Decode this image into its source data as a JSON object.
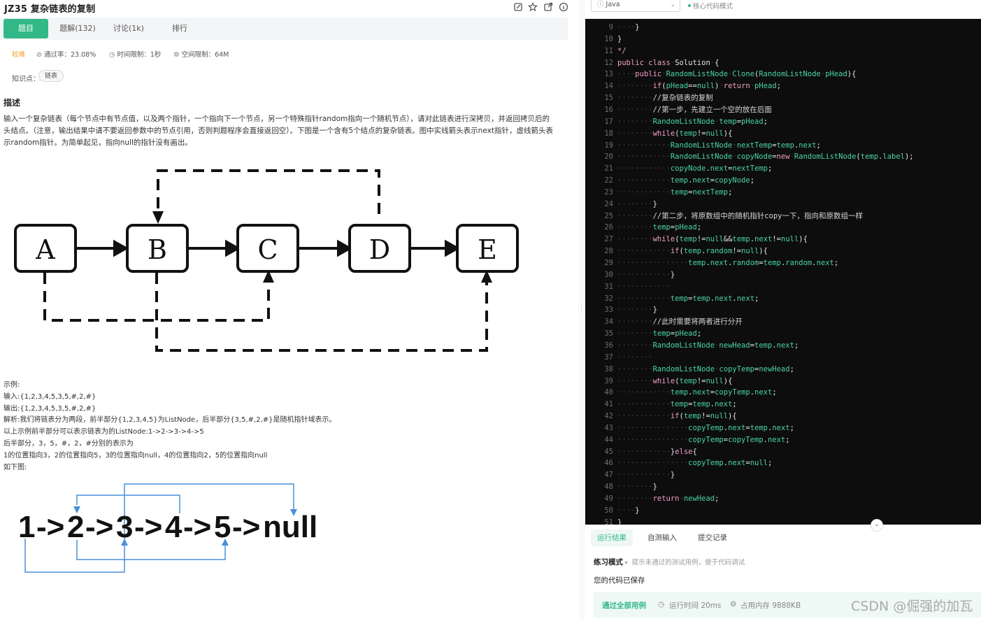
{
  "header": {
    "title": "JZ35  复杂链表的复制"
  },
  "tabs": [
    {
      "label": "题目"
    },
    {
      "label": "题解(132)"
    },
    {
      "label": "讨论(1k)"
    },
    {
      "label": "排行"
    }
  ],
  "meta": {
    "difficulty": "较难",
    "pass_rate": "通过率：23.08%",
    "time_limit": "时间限制：1秒",
    "space_limit": "空间限制：64M"
  },
  "knowledge": {
    "label": "知识点：",
    "tag": "链表"
  },
  "description": {
    "heading": "描述",
    "text": "输入一个复杂链表（每个节点中有节点值，以及两个指针，一个指向下一个节点，另一个特殊指针random指向一个随机节点），请对此链表进行深拷贝，并返回拷贝后的头结点。（注意，输出结果中请不要返回参数中的节点引用，否则判题程序会直接返回空）。下图是一个含有5个结点的复杂链表。图中实线箭头表示next指针，虚线箭头表示random指针。为简单起见，指向null的指针没有画出。"
  },
  "diagram1": {
    "nodes": [
      "A",
      "B",
      "C",
      "D",
      "E"
    ]
  },
  "example": {
    "lines": [
      "示例:",
      "输入:{1,2,3,4,5,3,5,#,2,#}",
      "输出:{1,2,3,4,5,3,5,#,2,#}",
      "解析:我们将链表分为两段，前半部分{1,2,3,4,5}为ListNode，后半部分{3,5,#,2,#}是随机指针域表示。",
      "以上示例前半部分可以表示链表为的ListNode:1->2->3->4->5",
      "后半部分，3，5，#，2，#分别的表示为",
      "1的位置指向3，2的位置指向5，3的位置指向null，4的位置指向2，5的位置指向null",
      "如下图:"
    ]
  },
  "diagram2": {
    "items": [
      "1",
      "->",
      "2",
      "->",
      "3",
      "->",
      "4",
      "->",
      "5",
      "->",
      "null"
    ]
  },
  "editor": {
    "language": "Java",
    "mode": "核心代码模式",
    "lines": [
      {
        "n": "9",
        "code": "····}"
      },
      {
        "n": "10",
        "code": "}"
      },
      {
        "n": "11",
        "code": "*/"
      },
      {
        "n": "12",
        "code": "public·class·Solution·{"
      },
      {
        "n": "13",
        "code": "····public·RandomListNode·Clone(RandomListNode·pHead){"
      },
      {
        "n": "14",
        "code": "········if(pHead==null)·return·pHead;"
      },
      {
        "n": "15",
        "code": "········//复杂链表的复制"
      },
      {
        "n": "16",
        "code": "········//第一步，先建立一个空的放在后面"
      },
      {
        "n": "17",
        "code": "········RandomListNode·temp=pHead;"
      },
      {
        "n": "18",
        "code": "········while(temp!=null){"
      },
      {
        "n": "19",
        "code": "············RandomListNode·nextTemp=temp.next;"
      },
      {
        "n": "20",
        "code": "············RandomListNode·copyNode=new·RandomListNode(temp.label);"
      },
      {
        "n": "21",
        "code": "············copyNode.next=nextTemp;"
      },
      {
        "n": "22",
        "code": "············temp.next=copyNode;"
      },
      {
        "n": "23",
        "code": "············temp=nextTemp;"
      },
      {
        "n": "24",
        "code": "········}"
      },
      {
        "n": "25",
        "code": "········//第二步，将原数组中的随机指针copy一下，指向和原数组一样"
      },
      {
        "n": "26",
        "code": "········temp=pHead;"
      },
      {
        "n": "27",
        "code": "········while(temp!=null&&temp.next!=null){"
      },
      {
        "n": "28",
        "code": "············if(temp.random!=null){"
      },
      {
        "n": "29",
        "code": "················temp.next.random=temp.random.next;"
      },
      {
        "n": "30",
        "code": "············}"
      },
      {
        "n": "31",
        "code": "············"
      },
      {
        "n": "32",
        "code": "············temp=temp.next.next;"
      },
      {
        "n": "33",
        "code": "········}"
      },
      {
        "n": "34",
        "code": "········//此时需要将两者进行分开"
      },
      {
        "n": "35",
        "code": "········temp=pHead;"
      },
      {
        "n": "36",
        "code": "········RandomListNode·newHead=temp.next;"
      },
      {
        "n": "37",
        "code": "········"
      },
      {
        "n": "38",
        "code": "········RandomListNode·copyTemp=newHead;"
      },
      {
        "n": "39",
        "code": "········while(temp!=null){"
      },
      {
        "n": "40",
        "code": "············temp.next=copyTemp.next;"
      },
      {
        "n": "41",
        "code": "············temp=temp.next;"
      },
      {
        "n": "42",
        "code": "············if(temp!=null){"
      },
      {
        "n": "43",
        "code": "················copyTemp.next=temp.next;"
      },
      {
        "n": "44",
        "code": "················copyTemp=copyTemp.next;"
      },
      {
        "n": "45",
        "code": "············}else{"
      },
      {
        "n": "46",
        "code": "················copyTemp.next=null;"
      },
      {
        "n": "47",
        "code": "············}"
      },
      {
        "n": "48",
        "code": "········}"
      },
      {
        "n": "49",
        "code": "········return·newHead;"
      },
      {
        "n": "50",
        "code": "····}"
      },
      {
        "n": "51",
        "code": "}"
      }
    ]
  },
  "results": {
    "tabs": [
      {
        "label": "运行结果"
      },
      {
        "label": "自测输入"
      },
      {
        "label": "提交记录"
      }
    ],
    "mode_label": "练习模式",
    "mode_hint": "提示未通过的测试用例，便于代码调试",
    "saved": "您的代码已保存",
    "pass_label": "通过全部用例",
    "run_time": "运行时间 20ms",
    "memory": "占用内存 9888KB"
  },
  "watermark": "CSDN @倔强的加瓦",
  "colors": {
    "accent": "#33b888",
    "difficulty": "#f0a020",
    "editor_bg": "#0d0d0d"
  }
}
